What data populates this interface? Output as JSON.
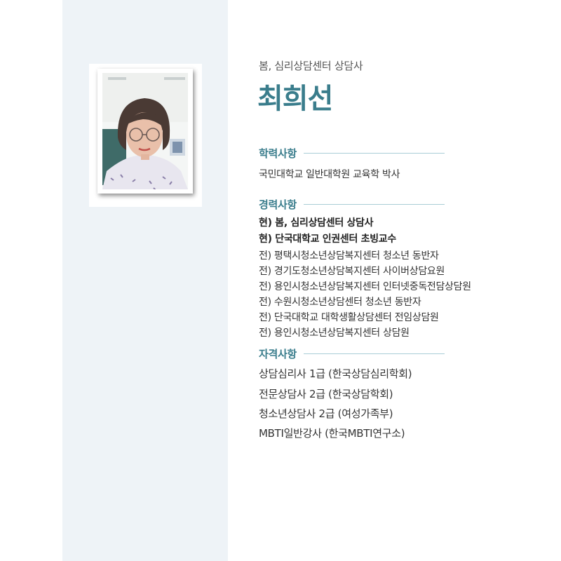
{
  "profile": {
    "subtitle": "봄, 심리상담센터 상담사",
    "name": "최희선"
  },
  "education": {
    "heading": "학력사항",
    "items": [
      "국민대학교 일반대학원 교육학 박사"
    ]
  },
  "career": {
    "heading": "경력사항",
    "items": [
      "현) 봄, 심리상담센터 상담사",
      "현) 단국대학교 인권센터 초빙교수",
      "전) 평택시청소년상담복지센터 청소년 동반자",
      "전) 경기도청소년상담복지센터 사이버상담요원",
      "전) 용인시청소년상담복지센터 인터넷중독전담상담원",
      "전) 수원시청소년상담센터 청소년 동반자",
      "전) 단국대학교 대학생활상담센터 전임상담원",
      "전) 용인시청소년상담복지센터 상담원"
    ]
  },
  "certifications": {
    "heading": "자격사항",
    "items": [
      "상담심리사 1급 (한국상담심리학회)",
      "전문상담사 2급 (한국상담학회)",
      "청소년상담사 2급 (여성가족부)",
      "MBTI일반강사 (한국MBTI연구소)"
    ]
  },
  "colors": {
    "accent": "#3a7d8c",
    "side_panel": "#eef3f7",
    "rule": "#a9cdd6"
  }
}
